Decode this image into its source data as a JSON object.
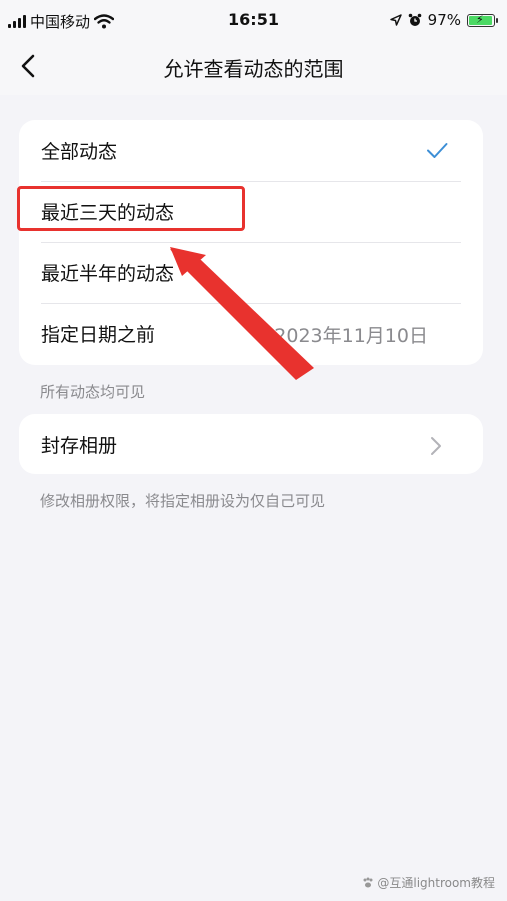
{
  "status_bar": {
    "carrier": "中国移动",
    "time": "16:51",
    "battery_percent": "97%",
    "battery_level": 0.97,
    "icons": [
      "signal-icon",
      "wifi-icon",
      "location-arrow-icon",
      "alarm-icon",
      "battery-charging-icon"
    ]
  },
  "nav": {
    "title": "允许查看动态的范围",
    "back_icon": "chevron-left-icon"
  },
  "range_options": [
    {
      "label": "全部动态",
      "selected": true
    },
    {
      "label": "最近三天的动态",
      "selected": false
    },
    {
      "label": "最近半年的动态",
      "selected": false
    },
    {
      "label": "指定日期之前",
      "value": "2023年11月10日",
      "selected": false
    }
  ],
  "range_note": "所有动态均可见",
  "album": {
    "label": "封存相册",
    "note": "修改相册权限，将指定相册设为仅自己可见"
  },
  "annotation": {
    "highlight_color": "#e8322e"
  },
  "accent_color": "#3d8fd6",
  "watermark": "@互通lightroom教程"
}
